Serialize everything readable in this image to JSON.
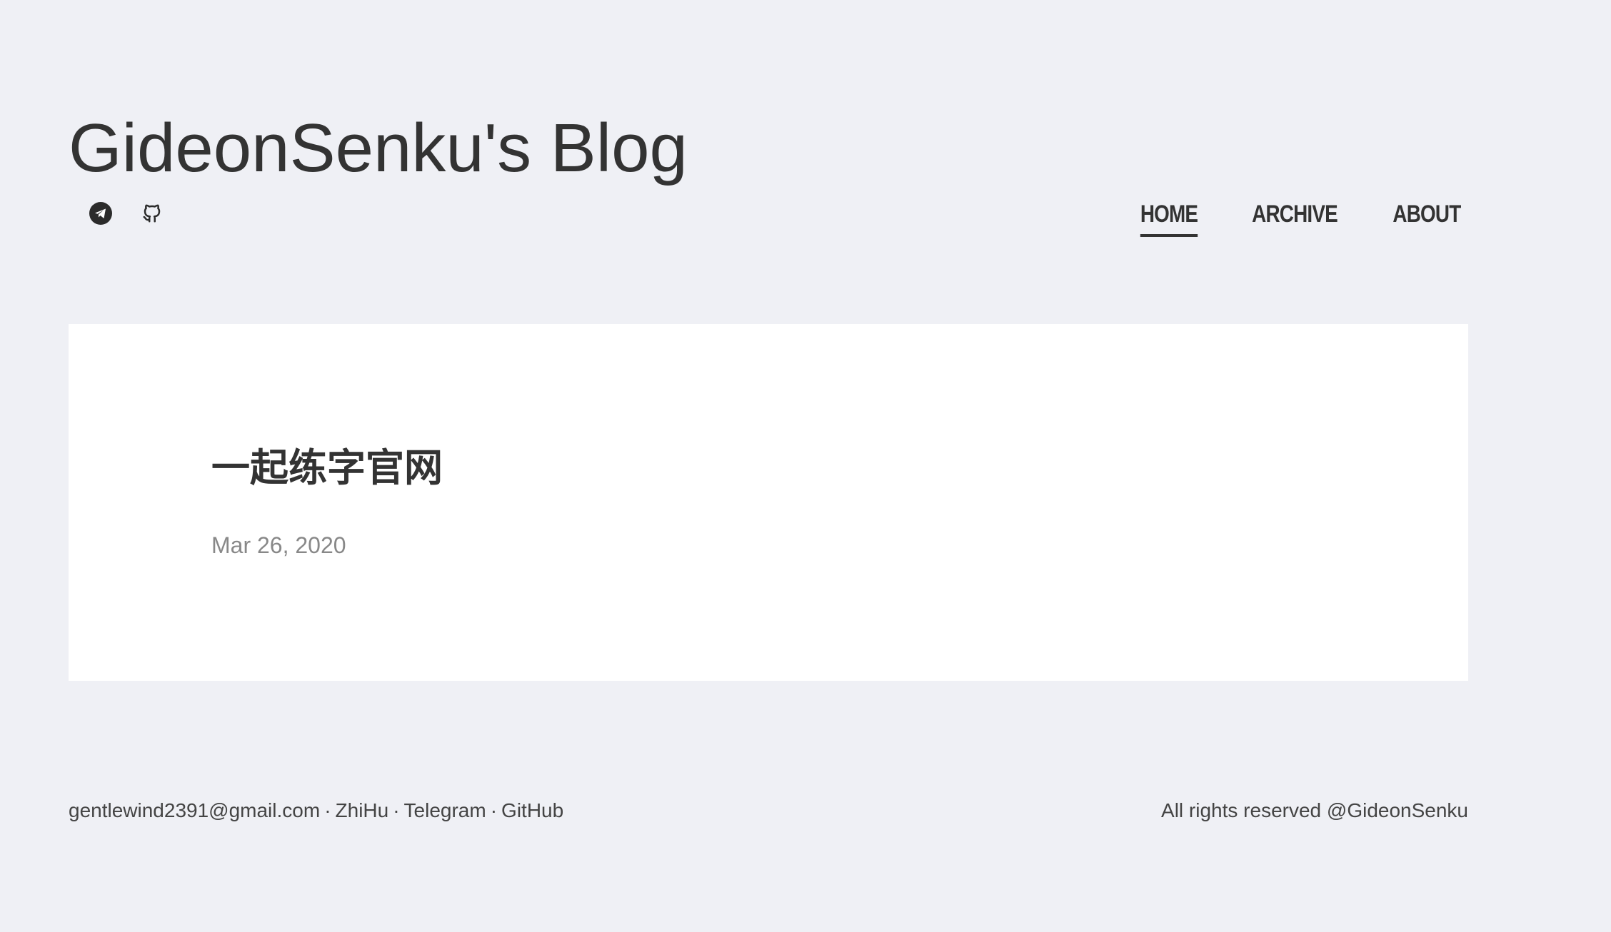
{
  "header": {
    "site_title": "GideonSenku's Blog",
    "social_icons": [
      {
        "icon": "telegram-icon"
      },
      {
        "icon": "github-icon"
      }
    ]
  },
  "nav": {
    "items": [
      {
        "label": "HOME",
        "active": true
      },
      {
        "label": "ARCHIVE",
        "active": false
      },
      {
        "label": "ABOUT",
        "active": false
      }
    ]
  },
  "post": {
    "title": "一起练字官网",
    "date": "Mar 26, 2020"
  },
  "footer": {
    "links": [
      {
        "label": "gentlewind2391@gmail.com"
      },
      {
        "label": "ZhiHu"
      },
      {
        "label": "Telegram"
      },
      {
        "label": "GitHub"
      }
    ],
    "separator": "·",
    "copyright": "All rights reserved @GideonSenku"
  },
  "colors": {
    "background": "#eff0f5",
    "card": "#ffffff",
    "text": "#333333",
    "muted": "#888888"
  }
}
